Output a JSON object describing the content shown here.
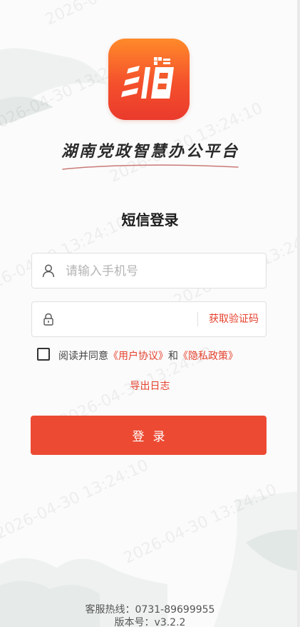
{
  "app": {
    "platform_title": "湖南党政智慧办公平台",
    "logo_icon": "xiang-logo-icon",
    "logo_colors": {
      "top": "#ff8a2a",
      "bottom": "#ea3a2c"
    }
  },
  "login": {
    "heading": "短信登录",
    "phone_placeholder": "请输入手机号",
    "phone_icon": "user-icon",
    "code_icon": "lock-icon",
    "get_code_label": "获取验证码",
    "agree_prefix": "阅读并同意",
    "user_agreement": "《用户协议》",
    "agree_and": "和",
    "privacy_policy": "《隐私政策》",
    "agreed": false,
    "export_log_label": "导出日志",
    "submit_label": "登录"
  },
  "watermark": {
    "text": "2026-04-30 13:24:10"
  },
  "footer": {
    "hotline": "客服热线：0731-89699955",
    "version": "版本号：v3.2.2"
  },
  "colors": {
    "accent": "#e5412d",
    "button": "#ec4a33"
  }
}
